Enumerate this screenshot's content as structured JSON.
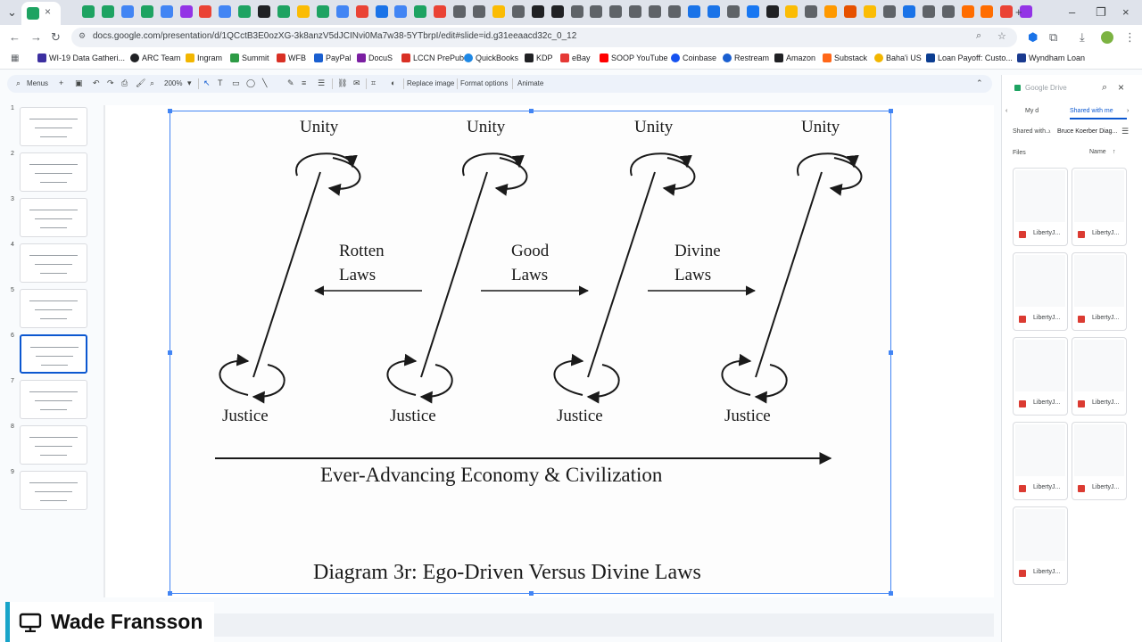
{
  "browser": {
    "url": "docs.google.com/presentation/d/1QCctB3E0ozXG-3k8anzV5dJCINvi0Ma7w38-5YTbrpI/edit#slide=id.g31eeaacd32c_0_12",
    "bookmarks": [
      "WI-19 Data Gatheri...",
      "ARC Team",
      "Ingram",
      "Summit",
      "WFB",
      "PayPal",
      "DocuS",
      "LCCN PrePub",
      "QuickBooks",
      "KDP",
      "eBay",
      "SOOP YouTube",
      "Coinbase",
      "Restream",
      "Amazon",
      "Substack",
      "Baha'i US",
      "Loan Payoff: Custo...",
      "Wyndham Loan"
    ],
    "bookmark_colors": [
      "#3c2fa0",
      "#202124",
      "#f2b600",
      "#2d9b45",
      "#d93025",
      "#1a5fd0",
      "#7b1fa2",
      "#d93025",
      "#1e88e5",
      "#202124",
      "#e53935",
      "#ff0000",
      "#1652f0",
      "#1a5fd0",
      "#202124",
      "#ff6719",
      "#f2b600",
      "#0b3d91",
      "#1a3a8f"
    ]
  },
  "toolbar": {
    "menus": "Menus",
    "zoom": "200%",
    "replace_image": "Replace image",
    "format_options": "Format options",
    "animate": "Animate"
  },
  "filmstrip": {
    "slides": [
      "1",
      "2",
      "3",
      "4",
      "5",
      "6",
      "7",
      "8",
      "9"
    ],
    "active_index": 6
  },
  "diagram": {
    "top_labels": [
      "Unity",
      "Unity",
      "Unity",
      "Unity"
    ],
    "bottom_labels": [
      "Justice",
      "Justice",
      "Justice",
      "Justice"
    ],
    "law_labels": [
      {
        "line1": "Rotten",
        "line2": "Laws"
      },
      {
        "line1": "Good",
        "line2": "Laws"
      },
      {
        "line1": "Divine",
        "line2": "Laws"
      }
    ],
    "axis_label": "Ever-Advancing Economy & Civilization",
    "caption": "Diagram 3r: Ego-Driven Versus Divine Laws"
  },
  "drive_panel": {
    "search_hint": "Google Drive",
    "tab_mine": "My d",
    "tab_shared": "Shared with me",
    "breadcrumb_root": "Shared with...",
    "breadcrumb_folder": "Bruce Koerber Diag...",
    "files_label": "Files",
    "name_label": "Name",
    "file_names": [
      "LibertyJ...",
      "LibertyJ...",
      "LibertyJ...",
      "LibertyJ...",
      "LibertyJ...",
      "LibertyJ...",
      "LibertyJ...",
      "LibertyJ...",
      "LibertyJ..."
    ]
  },
  "presenter": {
    "name": "Wade Fransson"
  }
}
